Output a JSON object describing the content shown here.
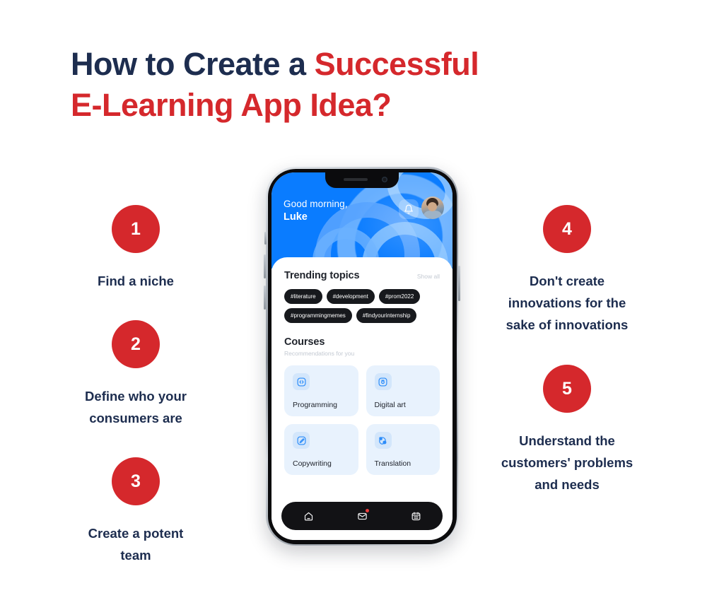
{
  "title": {
    "line1_plain": "How to Create a ",
    "line1_accent": "Successful",
    "line2": "E-Learning App Idea?"
  },
  "colors": {
    "accent_red": "#d5282c",
    "navy": "#1d2d4f",
    "app_blue": "#0a7cff",
    "card_blue": "#e8f2fd"
  },
  "steps": [
    {
      "number": "1",
      "label": "Find a niche"
    },
    {
      "number": "2",
      "label": "Define who your\nconsumers are"
    },
    {
      "number": "3",
      "label": "Create a potent\nteam"
    },
    {
      "number": "4",
      "label": "Don't create\ninnovations for the\nsake of innovations"
    },
    {
      "number": "5",
      "label": "Understand the\ncustomers' problems\nand needs"
    }
  ],
  "steps_left": [
    {
      "number": "1",
      "label_line1": "Find a niche",
      "label_line2": "",
      "label_line3": ""
    },
    {
      "number": "2",
      "label_line1": "Define who your",
      "label_line2": "consumers are",
      "label_line3": ""
    },
    {
      "number": "3",
      "label_line1": "Create a potent",
      "label_line2": "team",
      "label_line3": ""
    }
  ],
  "steps_right": [
    {
      "number": "4",
      "label_line1": "Don't create",
      "label_line2": "innovations for the",
      "label_line3": "sake of innovations"
    },
    {
      "number": "5",
      "label_line1": "Understand the",
      "label_line2": "customers' problems",
      "label_line3": "and needs"
    }
  ],
  "phone": {
    "hero": {
      "greeting": "Good morning,",
      "user_name": "Luke",
      "bell_icon": "bell-icon",
      "avatar_icon": "user-avatar"
    },
    "trending": {
      "title": "Trending topics",
      "show_all": "Show all",
      "tags": [
        "#literature",
        "#development",
        "#prom2022",
        "#programmingmemes",
        "#findyourinternship"
      ]
    },
    "courses": {
      "title": "Courses",
      "subtitle": "Recommendations for you",
      "items": [
        {
          "name": "Programming",
          "icon": "code-icon"
        },
        {
          "name": "Digital art",
          "icon": "camera-icon"
        },
        {
          "name": "Copywriting",
          "icon": "pencil-edit-icon"
        },
        {
          "name": "Translation",
          "icon": "translate-icon"
        }
      ]
    },
    "tabbar": [
      {
        "icon": "home-icon",
        "badge": false
      },
      {
        "icon": "mail-icon",
        "badge": true
      },
      {
        "icon": "calendar-icon",
        "badge": false
      }
    ]
  }
}
